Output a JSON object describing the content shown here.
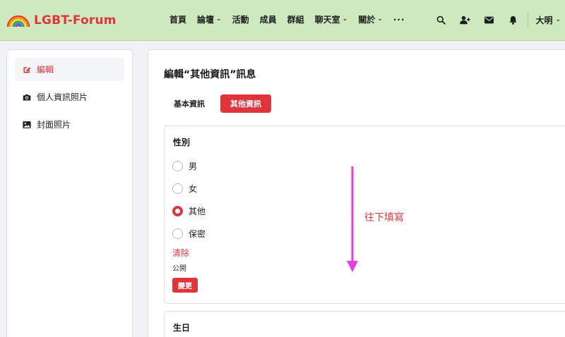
{
  "header": {
    "logo_text": "LGBT-Forum",
    "nav": [
      {
        "label": "首頁",
        "dropdown": false
      },
      {
        "label": "論壇",
        "dropdown": true
      },
      {
        "label": "活動",
        "dropdown": false
      },
      {
        "label": "成員",
        "dropdown": false
      },
      {
        "label": "群組",
        "dropdown": false
      },
      {
        "label": "聊天室",
        "dropdown": true
      },
      {
        "label": "關於",
        "dropdown": true
      }
    ],
    "more_label": "···",
    "icons": [
      "search-icon",
      "add-user-icon",
      "envelope-icon",
      "bell-icon"
    ],
    "user_name": "大明"
  },
  "sidebar": {
    "items": [
      {
        "label": "編輯",
        "icon": "edit-icon",
        "active": true
      },
      {
        "label": "個人資訊照片",
        "icon": "camera-icon",
        "active": false
      },
      {
        "label": "封面照片",
        "icon": "image-icon",
        "active": false
      }
    ]
  },
  "main": {
    "title": "編輯“其他資訊”訊息",
    "tabs": [
      {
        "label": "基本資訊",
        "active": false
      },
      {
        "label": "其他資訊",
        "active": true
      }
    ],
    "gender": {
      "title": "性別",
      "options": [
        {
          "label": "男",
          "checked": false
        },
        {
          "label": "女",
          "checked": false
        },
        {
          "label": "其他",
          "checked": true
        },
        {
          "label": "保密",
          "checked": false
        }
      ],
      "clear_label": "清除",
      "visibility_label": "公開",
      "change_button": "變更"
    },
    "birthday": {
      "title": "生日"
    }
  },
  "annotation": {
    "text": "往下填寫",
    "color": "#e83ee0"
  },
  "colors": {
    "accent": "#e0343c",
    "header_bg": "#cfe9be"
  }
}
